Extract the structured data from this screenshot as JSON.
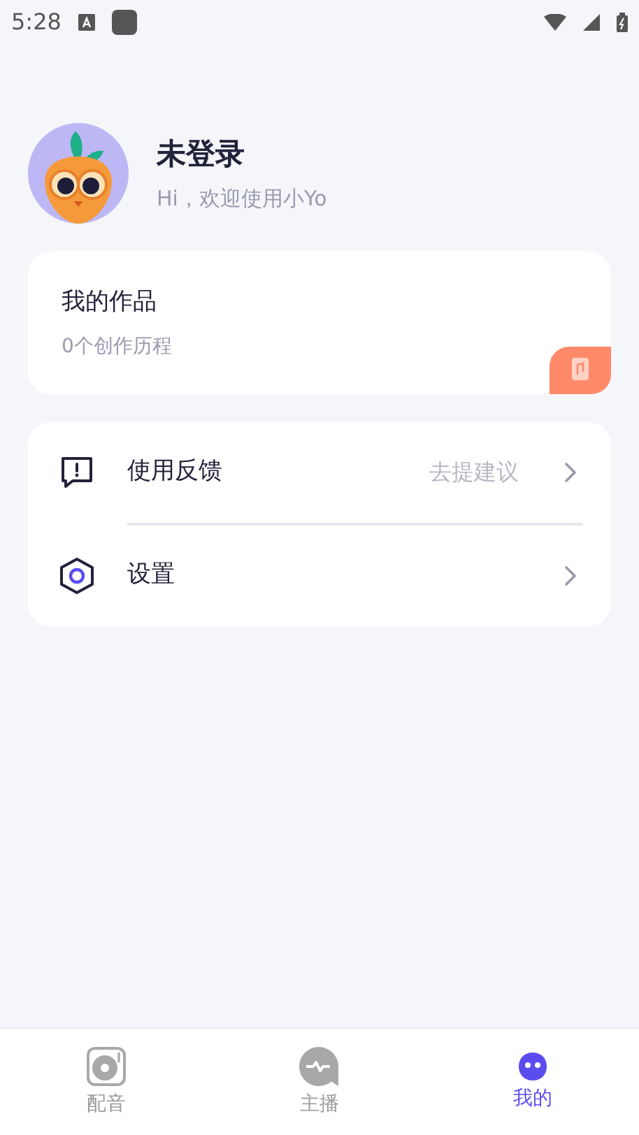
{
  "status_bar": {
    "time": "5:28"
  },
  "profile": {
    "name": "未登录",
    "greeting": "Hi，欢迎使用小Yo"
  },
  "works_card": {
    "title": "我的作品",
    "subtitle": "0个创作历程"
  },
  "menu": [
    {
      "kind": "feedback",
      "label": "使用反馈",
      "hint": "去提建议"
    },
    {
      "kind": "settings",
      "label": "设置"
    }
  ],
  "tabs": [
    {
      "kind": "dubbing",
      "label": "配音",
      "selected": false
    },
    {
      "kind": "anchor",
      "label": "主播",
      "selected": false
    },
    {
      "kind": "mine",
      "label": "我的",
      "selected": true
    }
  ]
}
